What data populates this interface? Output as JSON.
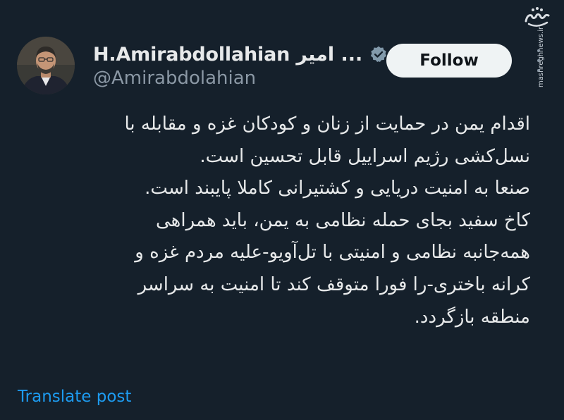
{
  "colors": {
    "background": "#15202b",
    "text_primary": "#e7e9ea",
    "text_secondary": "#8b98a5",
    "link": "#1d9bf0",
    "verified_badge": "#829aab",
    "follow_button_bg": "#eff3f4"
  },
  "watermark": {
    "logo_text": "مشرق",
    "url": "mashreghnews.ir"
  },
  "author": {
    "avatar_icon": "profile-photo",
    "display_name": "H.Amirabdollahian امیر ...",
    "verified_icon": "verified-badge-icon",
    "handle": "@Amirabdolahian"
  },
  "actions": {
    "follow_label": "Follow",
    "more_icon": "more-vertical-icon"
  },
  "tweet": {
    "lines": [
      "اقدام یمن در حمایت از زنان و کودکان غزه و مقابله با",
      "نسل‌کشی رژیم اسراییل قابل تحسین است.",
      "صنعا به امنیت دریایی و کشتیرانی کاملا پایبند است.",
      "کاخ سفید بجای حمله نظامی به یمن، باید همراهی",
      "همه‌جانبه نظامی و امنیتی با تل‌آویو-علیه مردم غزه و",
      "کرانه باختری-را فورا متوقف کند تا امنیت به سراسر",
      "منطقه بازگردد."
    ]
  },
  "footer": {
    "translate_label": "Translate post"
  }
}
